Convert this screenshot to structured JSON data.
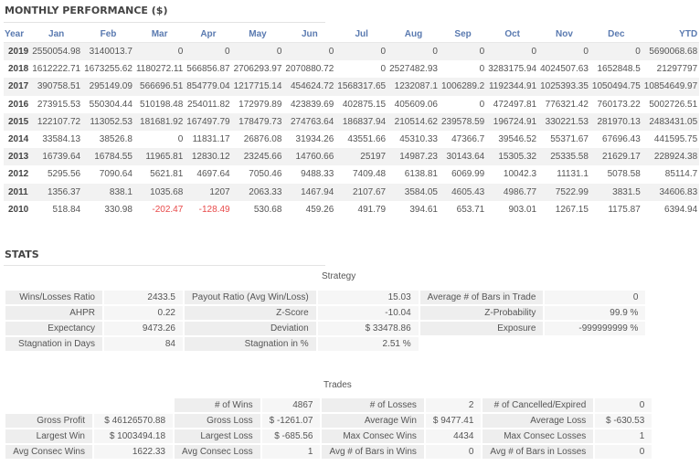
{
  "monthly": {
    "title": "MONTHLY PERFORMANCE ($)",
    "columns": [
      "Year",
      "Jan",
      "Feb",
      "Mar",
      "Apr",
      "May",
      "Jun",
      "Jul",
      "Aug",
      "Sep",
      "Oct",
      "Nov",
      "Dec",
      "YTD"
    ],
    "rows": [
      [
        "2019",
        "2550054.98",
        "3140013.7",
        "0",
        "0",
        "0",
        "0",
        "0",
        "0",
        "0",
        "0",
        "0",
        "0",
        "5690068.68"
      ],
      [
        "2018",
        "1612222.71",
        "1673255.62",
        "1180272.11",
        "566856.87",
        "2706293.97",
        "2070880.72",
        "0",
        "2527482.93",
        "0",
        "3283175.94",
        "4024507.63",
        "1652848.5",
        "21297797"
      ],
      [
        "2017",
        "390758.51",
        "295149.09",
        "566696.51",
        "854779.04",
        "1217715.14",
        "454624.72",
        "1568317.65",
        "1232087.1",
        "1006289.2",
        "1192344.91",
        "1025393.35",
        "1050494.75",
        "10854649.97"
      ],
      [
        "2016",
        "273915.53",
        "550304.44",
        "510198.48",
        "254011.82",
        "172979.89",
        "423839.69",
        "402875.15",
        "405609.06",
        "0",
        "472497.81",
        "776321.42",
        "760173.22",
        "5002726.51"
      ],
      [
        "2015",
        "122107.72",
        "113052.53",
        "181681.92",
        "167497.79",
        "178479.73",
        "274763.64",
        "186837.94",
        "210514.62",
        "239578.59",
        "196724.91",
        "330221.53",
        "281970.13",
        "2483431.05"
      ],
      [
        "2014",
        "33584.13",
        "38526.8",
        "0",
        "11831.17",
        "26876.08",
        "31934.26",
        "43551.66",
        "45310.33",
        "47366.7",
        "39546.52",
        "55371.67",
        "67696.43",
        "441595.75"
      ],
      [
        "2013",
        "16739.64",
        "16784.55",
        "11965.81",
        "12830.12",
        "23245.66",
        "14760.66",
        "25197",
        "14987.23",
        "30143.64",
        "15305.32",
        "25335.58",
        "21629.17",
        "228924.38"
      ],
      [
        "2012",
        "5295.56",
        "7090.64",
        "5621.81",
        "4697.64",
        "7050.46",
        "9488.33",
        "7409.48",
        "6138.81",
        "6069.99",
        "10042.3",
        "11131.1",
        "5078.58",
        "85114.7"
      ],
      [
        "2011",
        "1356.37",
        "838.1",
        "1035.68",
        "1207",
        "2063.33",
        "1467.94",
        "2107.67",
        "3584.05",
        "4605.43",
        "4986.77",
        "7522.99",
        "3831.5",
        "34606.83"
      ],
      [
        "2010",
        "518.84",
        "330.98",
        "-202.47",
        "-128.49",
        "530.68",
        "459.26",
        "491.79",
        "394.61",
        "653.71",
        "903.01",
        "1267.15",
        "1175.87",
        "6394.94"
      ]
    ],
    "negative_color": "#e84a4a",
    "header_color": "#5a7ab0"
  },
  "stats": {
    "title": "STATS",
    "strategy": {
      "caption": "Strategy",
      "rows": [
        [
          "Wins/Losses Ratio",
          "2433.5",
          "Payout Ratio (Avg Win/Loss)",
          "15.03",
          "Average # of Bars in Trade",
          "0"
        ],
        [
          "AHPR",
          "0.22",
          "Z-Score",
          "-10.04",
          "Z-Probability",
          "99.9 %"
        ],
        [
          "Expectancy",
          "9473.26",
          "Deviation",
          "$ 33478.86",
          "Exposure",
          "-999999999 %"
        ],
        [
          "Stagnation in Days",
          "84",
          "Stagnation in %",
          "2.51 %",
          "",
          ""
        ]
      ]
    },
    "trades": {
      "caption": "Trades",
      "rows": [
        [
          "",
          "",
          "# of Wins",
          "4867",
          "# of Losses",
          "2",
          "# of Cancelled/Expired",
          "0"
        ],
        [
          "Gross Profit",
          "$ 46126570.88",
          "Gross Loss",
          "$ -1261.07",
          "Average Win",
          "$ 9477.41",
          "Average Loss",
          "$ -630.53"
        ],
        [
          "Largest Win",
          "$ 1003494.18",
          "Largest Loss",
          "$ -685.56",
          "Max Consec Wins",
          "4434",
          "Max Consec Losses",
          "1"
        ],
        [
          "Avg Consec Wins",
          "1622.33",
          "Avg Consec Loss",
          "1",
          "Avg # of Bars in Wins",
          "0",
          "Avg # of Bars in Losses",
          "0"
        ]
      ]
    }
  }
}
